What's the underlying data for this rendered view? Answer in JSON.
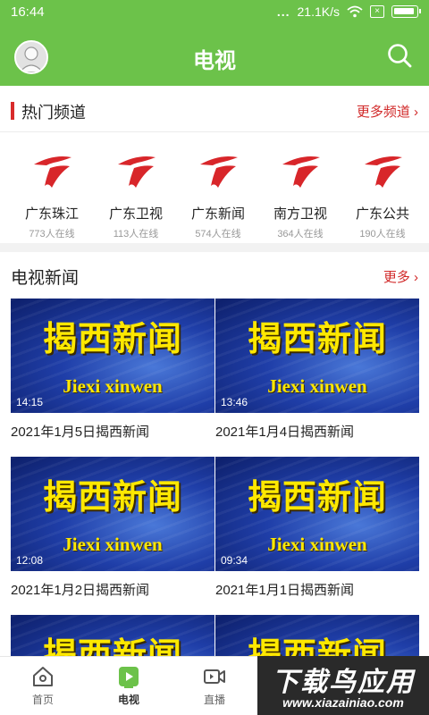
{
  "status_bar": {
    "time": "16:44",
    "dots": "...",
    "speed": "21.1K/s"
  },
  "header": {
    "title": "电视",
    "icons": [
      "user-avatar",
      "search-icon"
    ]
  },
  "hot_channels": {
    "title": "热门频道",
    "more": "更多频道 ›",
    "accent": "#d82b2b",
    "items": [
      {
        "name": "广东珠江",
        "count": "773人在线"
      },
      {
        "name": "广东卫视",
        "count": "113人在线"
      },
      {
        "name": "广东新闻",
        "count": "574人在线"
      },
      {
        "name": "南方卫视",
        "count": "364人在线"
      },
      {
        "name": "广东公共",
        "count": "190人在线"
      }
    ]
  },
  "tv_news": {
    "title": "电视新闻",
    "more": "更多 ›",
    "thumb_cn": "揭西新闻",
    "thumb_en": "Jiexi xinwen",
    "items": [
      {
        "duration": "14:15",
        "title": "2021年1月5日揭西新闻"
      },
      {
        "duration": "13:46",
        "title": "2021年1月4日揭西新闻"
      },
      {
        "duration": "12:08",
        "title": "2021年1月2日揭西新闻"
      },
      {
        "duration": "09:34",
        "title": "2021年1月1日揭西新闻"
      }
    ]
  },
  "bottom_nav": {
    "tabs": [
      {
        "label": "首页",
        "icon": "home-icon"
      },
      {
        "label": "电视",
        "icon": "tv-play-icon",
        "active": true
      },
      {
        "label": "直播",
        "icon": "live-video-icon"
      }
    ]
  },
  "watermark": {
    "main": "下载鸟应用",
    "url": "www.xiazainiao.com"
  },
  "colors": {
    "header_green": "#6cc24a",
    "link_red": "#d12828",
    "thumb_yellow": "#ffe800"
  }
}
